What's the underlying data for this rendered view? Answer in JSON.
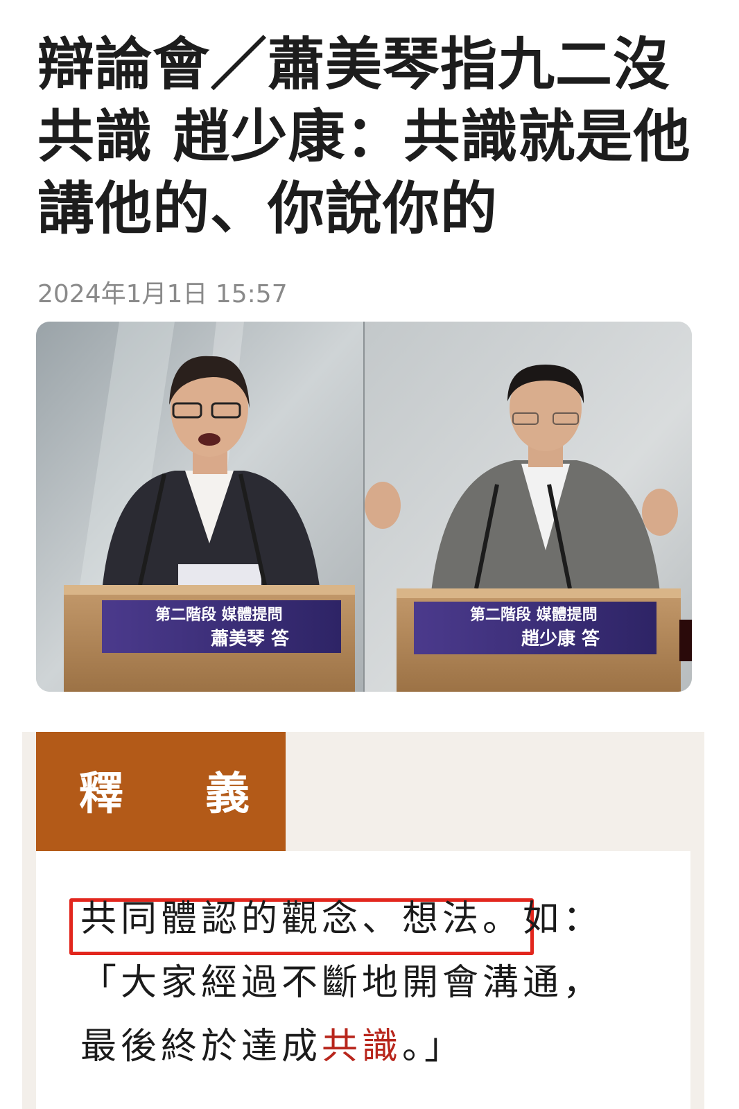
{
  "article": {
    "headline_line1": "辯論會／蕭美琴指九二沒",
    "headline_line2": "共識 趙少康：共識就是他",
    "headline_line3": "講他的、你說你的",
    "timestamp": "2024年1月1日 15:57"
  },
  "photo": {
    "left_podium_title": "第二階段 媒體提問",
    "left_podium_name": "蕭美琴 答",
    "right_podium_title": "第二階段 媒體提問",
    "right_podium_name": "趙少康 答"
  },
  "definition": {
    "header_char1": "釋",
    "header_char2": "義",
    "line1_highlighted": "共同體認的觀念、想法。",
    "line1_rest": "如：",
    "line2": "「大家經過不斷地開會溝通，",
    "line3_pre": "最後終於達成",
    "line3_red": "共識",
    "line3_post": "。」"
  },
  "colors": {
    "header_bg": "#b35a18",
    "box_bg": "#f3efea",
    "highlight_border": "#e2261d",
    "emphasis_text": "#b8261c"
  }
}
